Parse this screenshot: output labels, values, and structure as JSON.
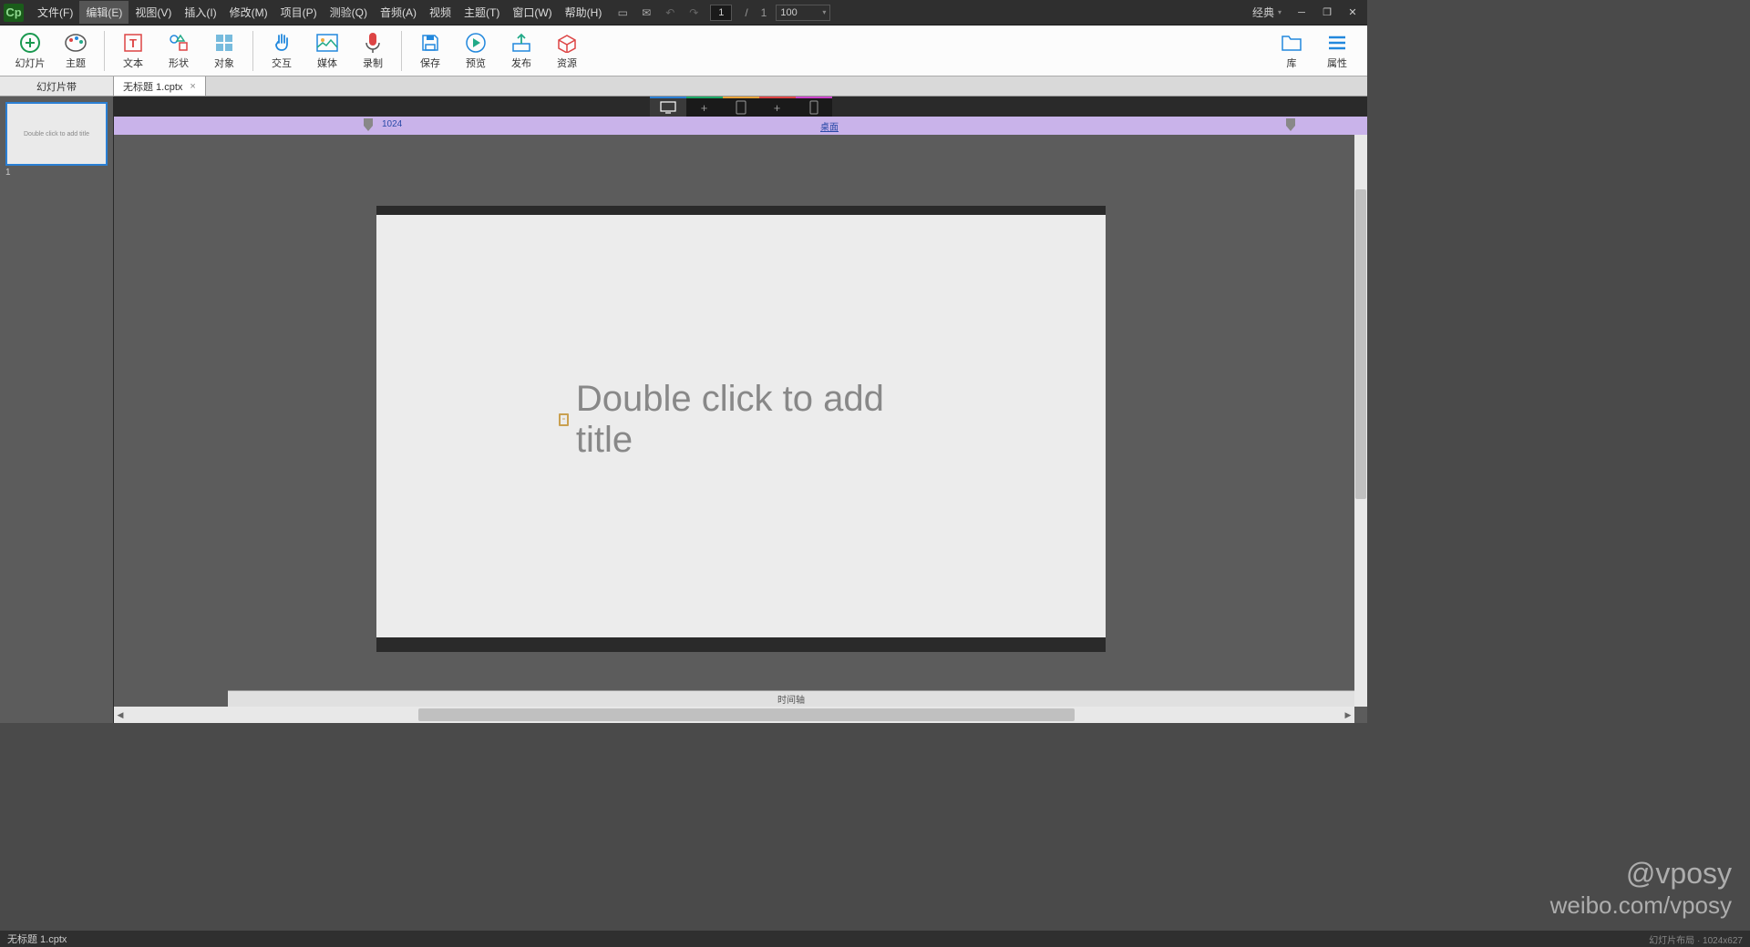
{
  "app": {
    "logo": "Cp"
  },
  "menubar": {
    "items": [
      {
        "label": "文件(F)"
      },
      {
        "label": "编辑(E)",
        "active": true
      },
      {
        "label": "视图(V)"
      },
      {
        "label": "插入(I)"
      },
      {
        "label": "修改(M)"
      },
      {
        "label": "项目(P)"
      },
      {
        "label": "测验(Q)"
      },
      {
        "label": "音频(A)"
      },
      {
        "label": "视频"
      },
      {
        "label": "主题(T)"
      },
      {
        "label": "窗口(W)"
      },
      {
        "label": "帮助(H)"
      }
    ],
    "page_current": "1",
    "page_total": "1",
    "zoom": "100",
    "workspace": "经典"
  },
  "toolbar": {
    "groups": [
      [
        {
          "id": "slides",
          "label": "幻灯片"
        },
        {
          "id": "theme",
          "label": "主题"
        }
      ],
      [
        {
          "id": "text",
          "label": "文本"
        },
        {
          "id": "shapes",
          "label": "形状"
        },
        {
          "id": "objects",
          "label": "对象"
        }
      ],
      [
        {
          "id": "interact",
          "label": "交互"
        },
        {
          "id": "media",
          "label": "媒体"
        },
        {
          "id": "record",
          "label": "录制"
        }
      ],
      [
        {
          "id": "save",
          "label": "保存"
        },
        {
          "id": "preview",
          "label": "预览"
        },
        {
          "id": "publish",
          "label": "发布"
        },
        {
          "id": "assets",
          "label": "资源"
        }
      ]
    ],
    "right": [
      {
        "id": "library",
        "label": "库"
      },
      {
        "id": "properties",
        "label": "属性"
      }
    ]
  },
  "tabs": {
    "panel": "幻灯片带",
    "doc": "无标题 1.cptx"
  },
  "thumbnail": {
    "text": "Double click to add title",
    "num": "1"
  },
  "ruler": {
    "value": "1024",
    "label": "桌面"
  },
  "slide": {
    "placeholder": "Double click to add title"
  },
  "timeline": {
    "label": "时间轴"
  },
  "status": {
    "file": "无标题 1.cptx",
    "layout_info": "幻灯片布局 · 1024x627"
  },
  "watermark": {
    "handle": "@vposy",
    "site": "weibo.com/vposy"
  }
}
